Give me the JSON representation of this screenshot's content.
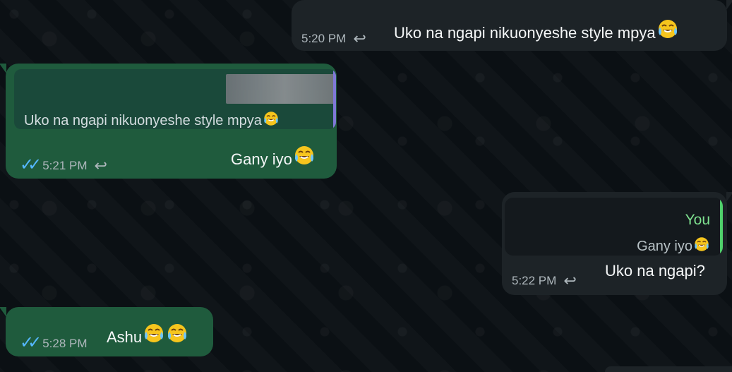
{
  "messages": [
    {
      "id": "msg-1",
      "direction": "outgoing",
      "text": "Uko na ngapi nikuonyeshe style mpya",
      "time": "5:20 PM",
      "icons": [
        "reply-icon",
        "tears-of-joy-emoji-icon"
      ]
    },
    {
      "id": "msg-2",
      "direction": "incoming",
      "quoted_text": "Uko na ngapi nikuonyeshe style mpya",
      "text": "Gany iyo",
      "time": "5:21 PM",
      "icons": [
        "double-check-icon",
        "reply-icon",
        "tears-of-joy-emoji-icon"
      ]
    },
    {
      "id": "msg-3",
      "direction": "outgoing",
      "reply_label": "You",
      "quoted_text": "Gany iyo",
      "text": "Uko na ngapi?",
      "time": "5:22 PM",
      "icons": [
        "reply-icon",
        "tears-of-joy-emoji-icon"
      ]
    },
    {
      "id": "msg-4",
      "direction": "incoming",
      "text": "Ashu",
      "time": "5:28 PM",
      "icons": [
        "double-check-icon",
        "tears-of-joy-emoji-icon",
        "tears-of-joy-emoji-icon"
      ]
    }
  ],
  "colors": {
    "background": "#0b1014",
    "green_bubble": "#1f5b3d",
    "dark_bubble": "#1d2327",
    "quote_bar_purple": "#7f78d7",
    "quote_bar_green": "#4fd06b",
    "tick_blue": "#55b7ff"
  }
}
